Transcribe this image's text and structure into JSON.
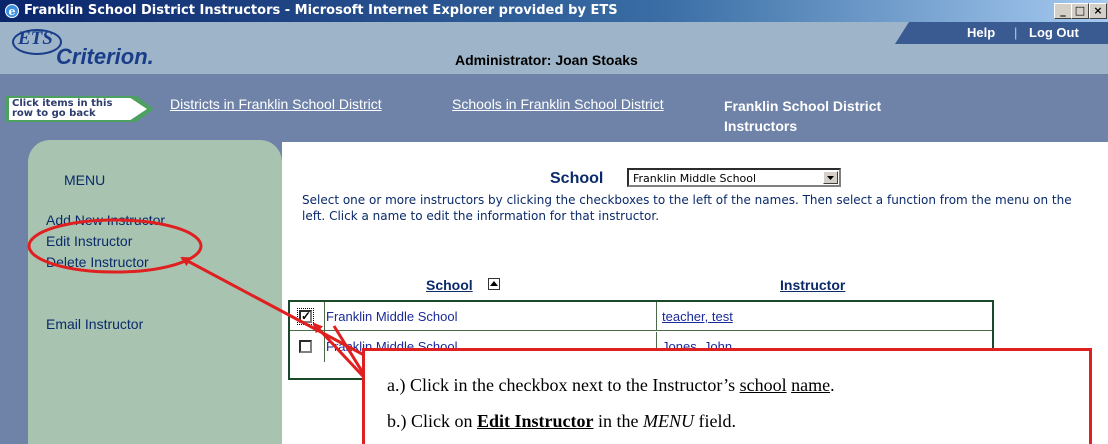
{
  "window": {
    "title": "Franklin School District Instructors - Microsoft Internet Explorer provided by ETS",
    "minimize": "_",
    "maximize": "□",
    "close": "×"
  },
  "header": {
    "logo_ets": "ETS",
    "logo_product": "Criterion.",
    "admin_label": "Administrator: Joan Stoaks",
    "help": "Help",
    "separator": "|",
    "logout": "Log Out"
  },
  "breadcrumb": {
    "back_hint_line1": "Click items in this",
    "back_hint_line2": "row to go back",
    "districts": "Districts in Franklin School District",
    "schools": "Schools in Franklin School District",
    "current": "Franklin School District Instructors"
  },
  "menu": {
    "title": "MENU",
    "items": [
      "Add New Instructor",
      "Edit Instructor",
      "Delete Instructor",
      "Email Instructor"
    ]
  },
  "school_filter": {
    "label": "School",
    "selected": "Franklin Middle School"
  },
  "instructions": "Select one or more instructors by clicking the checkboxes to the left of the names. Then select a function from the menu on the left. Click a name to edit the information for that instructor.",
  "table": {
    "headers": [
      "School",
      "Instructor"
    ],
    "rows": [
      {
        "checked": "✓",
        "school": "Franklin Middle School",
        "instructor": "teacher, test"
      },
      {
        "checked": "",
        "school": "Franklin Middle School",
        "instructor": "Jones, John"
      }
    ]
  },
  "callout": {
    "a_prefix": "a.)  Click in the checkbox next to the Instructor’s ",
    "a_school": "school",
    "a_space": " ",
    "a_name": "name",
    "a_end": ".",
    "b_prefix": "b.)  Click on ",
    "b_bold": "Edit Instructor",
    "b_mid": " in the ",
    "b_menu": "MENU",
    "b_end": " field."
  },
  "colors": {
    "annotation_red": "#e02020",
    "header_blue": "#6f83a8",
    "menu_green": "#a8c4b0"
  }
}
